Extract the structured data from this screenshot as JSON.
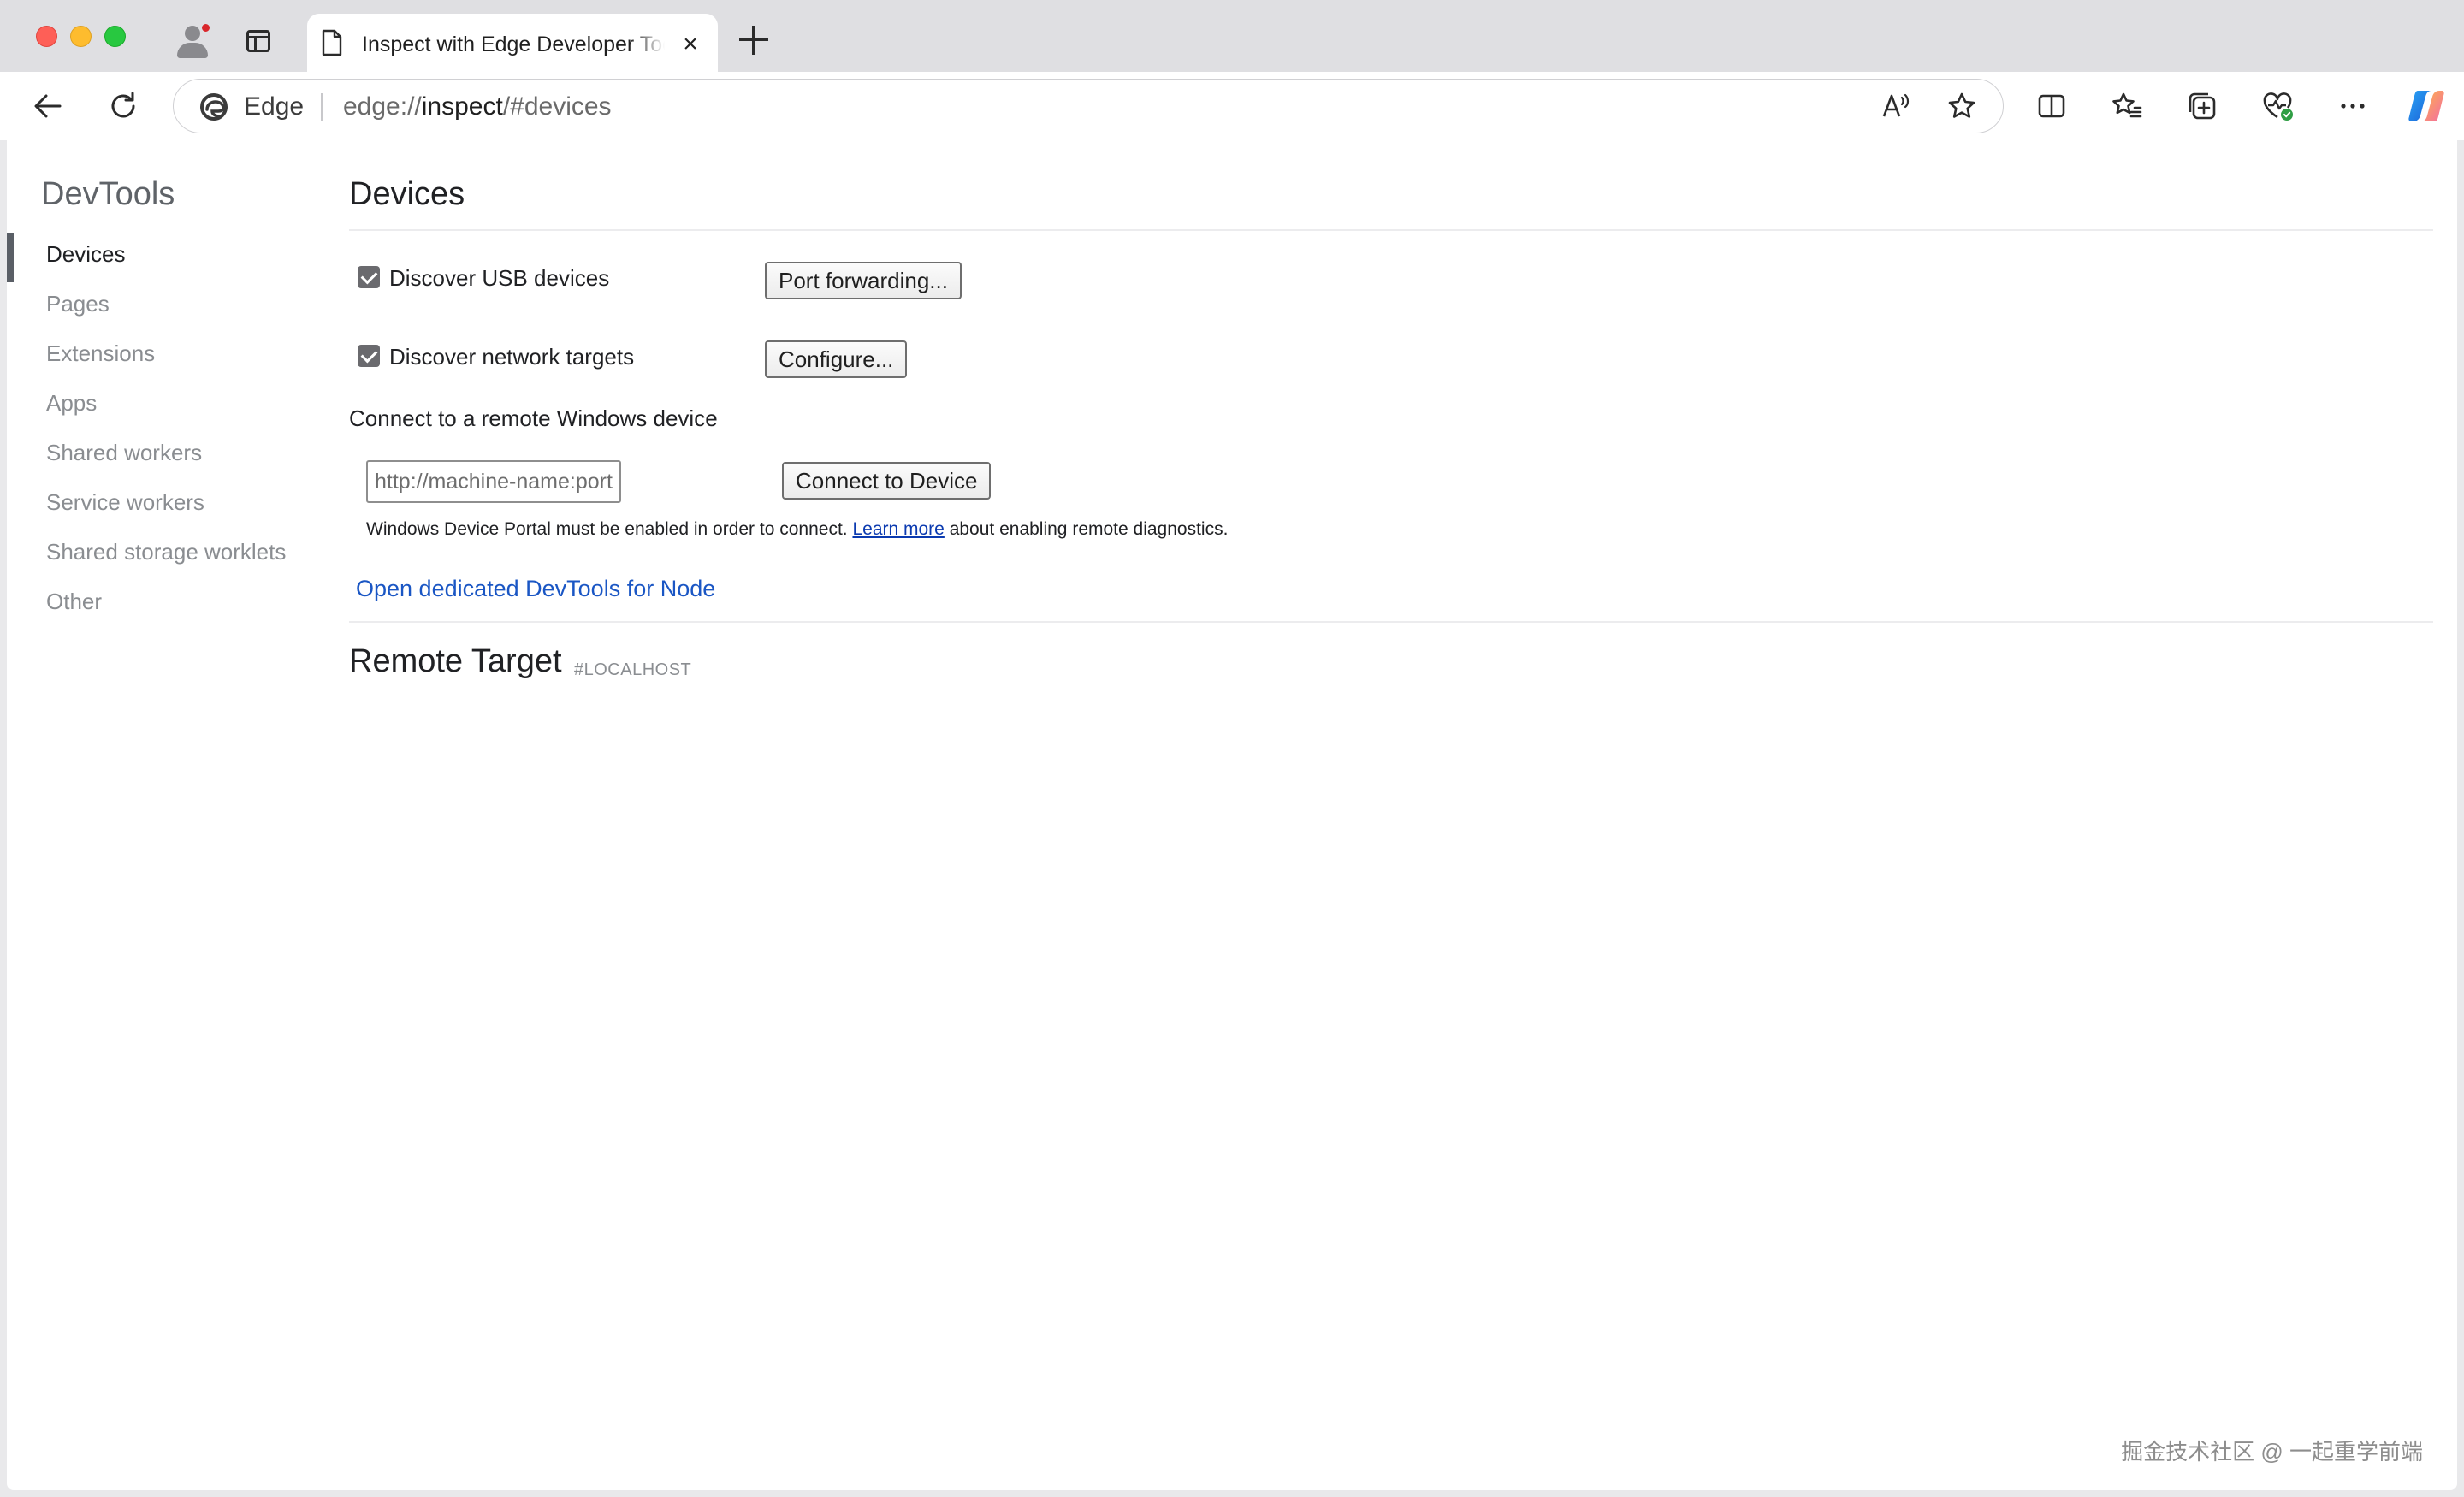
{
  "browser": {
    "tab": {
      "title": "Inspect with Edge Developer Tools",
      "close_symbol": "×"
    },
    "address": {
      "brand": "Edge",
      "url_scheme": "edge://",
      "url_host": "inspect",
      "url_path": "/#devices"
    }
  },
  "sidebar": {
    "heading": "DevTools",
    "items": [
      {
        "label": "Devices",
        "selected": true
      },
      {
        "label": "Pages"
      },
      {
        "label": "Extensions"
      },
      {
        "label": "Apps"
      },
      {
        "label": "Shared workers"
      },
      {
        "label": "Service workers"
      },
      {
        "label": "Shared storage worklets"
      },
      {
        "label": "Other"
      }
    ]
  },
  "main": {
    "title": "Devices",
    "usb": {
      "label": "Discover USB devices",
      "checked": true,
      "button": "Port forwarding..."
    },
    "network": {
      "label": "Discover network targets",
      "checked": true,
      "button": "Configure..."
    },
    "remote_windows": {
      "label": "Connect to a remote Windows device",
      "input_placeholder": "http://machine-name:port",
      "button": "Connect to Device",
      "hint_before": "Windows Device Portal must be enabled in order to connect. ",
      "hint_link": "Learn more",
      "hint_after": " about enabling remote diagnostics."
    },
    "node_link": "Open dedicated DevTools for Node",
    "remote_target": {
      "title": "Remote Target",
      "subtitle": "#LOCALHOST"
    }
  },
  "watermark": "掘金技术社区 @ 一起重学前端",
  "colors": {
    "link": "#1a56c4",
    "selected_indicator": "#5a5f66",
    "close_red": "#fe5f57",
    "minimize_yellow": "#febc2e",
    "zoom_green": "#28c840"
  }
}
